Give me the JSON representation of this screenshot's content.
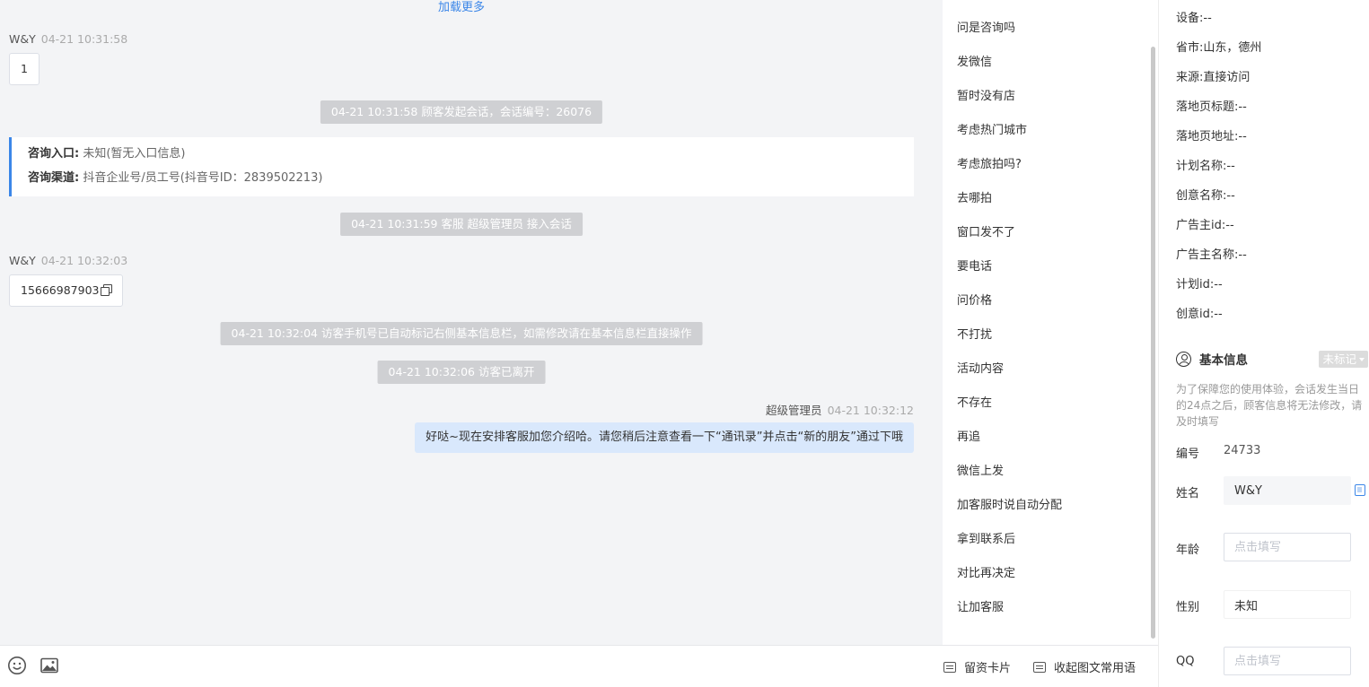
{
  "chat": {
    "load_more": "加载更多",
    "messages": [
      {
        "sender": "W&Y",
        "time": "04-21 10:31:58",
        "text": "1"
      },
      {
        "system": "04-21 10:31:58 顾客发起会话，会话编号：26076"
      },
      {
        "system": "04-21 10:31:59 客服 超级管理员 接入会话"
      },
      {
        "sender": "W&Y",
        "time": "04-21 10:32:03",
        "text": "15666987903"
      },
      {
        "system": "04-21 10:32:04 访客手机号已自动标记右侧基本信息栏，如需修改请在基本信息栏直接操作"
      },
      {
        "system": "04-21 10:32:06 访客已离开"
      },
      {
        "sender": "超级管理员",
        "time": "04-21 10:32:12",
        "text": "好哒~现在安排客服加您介绍哈。请您稍后注意查看一下“通讯录”并点击“新的朋友”通过下哦"
      }
    ],
    "entry": {
      "entry_label": "咨询入口:",
      "entry_value": "未知(暂无入口信息)",
      "channel_label": "咨询渠道:",
      "channel_value": "抖音企业号/员工号(抖音号ID：2839502213)"
    }
  },
  "input_bar": {
    "emoji_icon": "smiley-icon",
    "image_icon": "image-icon",
    "lead_card": "留资卡片",
    "collapse_phrases": "收起图文常用语"
  },
  "quick_replies": [
    "问是咨询吗",
    "发微信",
    "暂时没有店",
    "考虑热门城市",
    "考虑旅拍吗?",
    "去哪拍",
    "窗口发不了",
    "要电话",
    "问价格",
    "不打扰",
    "活动内容",
    "不存在",
    "再追",
    "微信上发",
    "加客服时说自动分配",
    "拿到联系后",
    "对比再决定",
    "让加客服"
  ],
  "info": {
    "visit": [
      {
        "label": "设备:",
        "value": "--"
      },
      {
        "label": "省市:",
        "value": "山东，德州"
      },
      {
        "label": "来源:",
        "value": "直接访问"
      },
      {
        "label": "落地页标题:",
        "value": "--"
      },
      {
        "label": "落地页地址:",
        "value": "--"
      },
      {
        "label": "计划名称:",
        "value": "--"
      },
      {
        "label": "创意名称:",
        "value": "--"
      },
      {
        "label": "广告主id:",
        "value": "--"
      },
      {
        "label": "广告主名称:",
        "value": "--"
      },
      {
        "label": "计划id:",
        "value": "--"
      },
      {
        "label": "创意id:",
        "value": "--"
      }
    ],
    "basic_title": "基本信息",
    "mark_label": "未标记",
    "notice": "为了保障您的使用体验，会话发生当日的24点之后，顾客信息将无法修改，请及时填写",
    "fields": {
      "id_label": "编号",
      "id_value": "24733",
      "name_label": "姓名",
      "name_value": "W&Y",
      "age_label": "年龄",
      "age_placeholder": "点击填写",
      "gender_label": "性别",
      "gender_value": "未知",
      "qq_label": "QQ",
      "qq_placeholder": "点击填写"
    }
  }
}
